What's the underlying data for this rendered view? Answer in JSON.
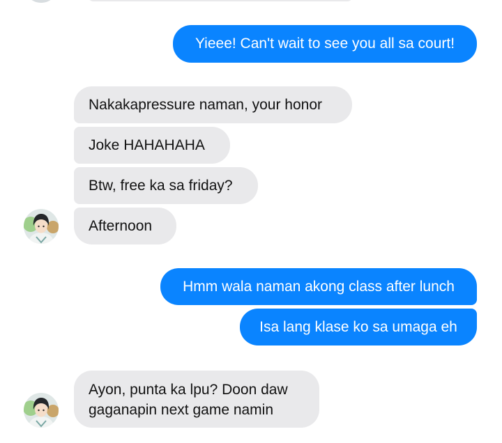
{
  "conversation": {
    "messages": [
      {
        "from": "me",
        "text": "Yieee! Can't wait to see you all sa court!"
      },
      {
        "from": "them",
        "text": "Nakakapressure naman, your honor"
      },
      {
        "from": "them",
        "text": "Joke HAHAHAHA"
      },
      {
        "from": "them",
        "text": "Btw, free ka sa friday?"
      },
      {
        "from": "them",
        "text": "Afternoon"
      },
      {
        "from": "me",
        "text": "Hmm wala naman akong class after lunch"
      },
      {
        "from": "me",
        "text": "Isa lang klase ko sa umaga eh"
      },
      {
        "from": "them",
        "line1": "Ayon, punta ka lpu? Doon daw",
        "line2": "gaganapin next game namin"
      }
    ]
  },
  "colors": {
    "sent_bubble": "#0a84ff",
    "received_bubble": "#e9e9eb",
    "sent_text": "#ffffff",
    "received_text": "#111111"
  },
  "icons": {
    "avatar": "contact-avatar-anime-character"
  }
}
